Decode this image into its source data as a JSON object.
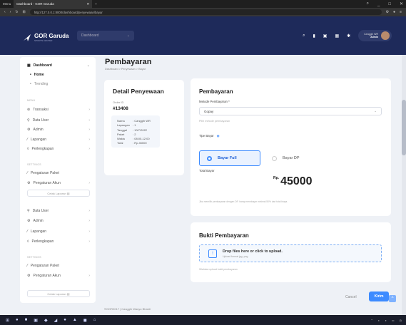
{
  "browser": {
    "tab_title": "Dashboard - GOR Garuda",
    "tab_label_menu": "Menu",
    "url": "http://127.0.0.1:8000/dashboard/penyewaan/bayar"
  },
  "header": {
    "brand": "GOR Garuda",
    "brand_sub": "SPORTS CENTER",
    "dashboard_pill": "Dashboard",
    "user_name": "Canggih WR",
    "user_role": "Admin"
  },
  "sidebar": {
    "dashboard": "Dashboard",
    "home": "Home",
    "trending": "Trending",
    "section_menu": "MENU",
    "menu": [
      "Transaksi",
      "Data User",
      "Admin",
      "Lapangan",
      "Perlengkapan"
    ],
    "section_settings": "SETTINGS",
    "settings": [
      "Pengaturan Paket",
      "Pengaturan Akun"
    ],
    "cetak": "Cetak Laporan",
    "menu2": [
      "Data User",
      "Admin",
      "Lapangan",
      "Perlengkapan"
    ],
    "section_settings2": "SETTINGS",
    "settings2": [
      "Pengaturan Paket",
      "Pengaturan Akun"
    ],
    "cetak2": "Cetak Laporan"
  },
  "page": {
    "title": "Pembayaran",
    "breadcrumb": "Dashboard  >  Penyewaan  >  Bayar"
  },
  "detail": {
    "title": "Detail Penyewaan",
    "order_label": "Order ID",
    "order_id": "#13408",
    "rows": [
      {
        "k": "Nama",
        "v": ": Canggih WR"
      },
      {
        "k": "Lapangan",
        "v": ": 1"
      },
      {
        "k": "Tanggal",
        "v": ": 10/7/2022"
      },
      {
        "k": "Paket",
        "v": ": 2"
      },
      {
        "k": "Waktu",
        "v": ": 08:00-12:00"
      },
      {
        "k": "Total",
        "v": ": Rp.45000"
      }
    ]
  },
  "payment": {
    "title": "Pembayaran",
    "method_label": "Metode Pembayaran *",
    "method_value": "Gopay",
    "method_hint": "Pilih metode pembayaran",
    "type_label": "Tipe Bayar",
    "opt_full": "Bayar Full",
    "opt_dp": "Bayar DP",
    "total_label": "Total Bayar",
    "currency": "Rp.",
    "total": "45000",
    "note": "Jika memilih pembayaran dengan DP, harap membayar minimal 50% dari total biaya."
  },
  "upload": {
    "title": "Bukti Pembayaran",
    "drop_text": "Drop files here or click to upload.",
    "drop_sub": "Upload format jpg, png",
    "hint": "Silahkan upload bukti pembayaran"
  },
  "actions": {
    "cancel": "Cancel",
    "submit": "Kirim"
  },
  "footer": {
    "text": "©GOR2017 | Canggih Wanyu Bhakti"
  },
  "colors": {
    "primary": "#3d8bff",
    "header": "#1e2a5a"
  }
}
